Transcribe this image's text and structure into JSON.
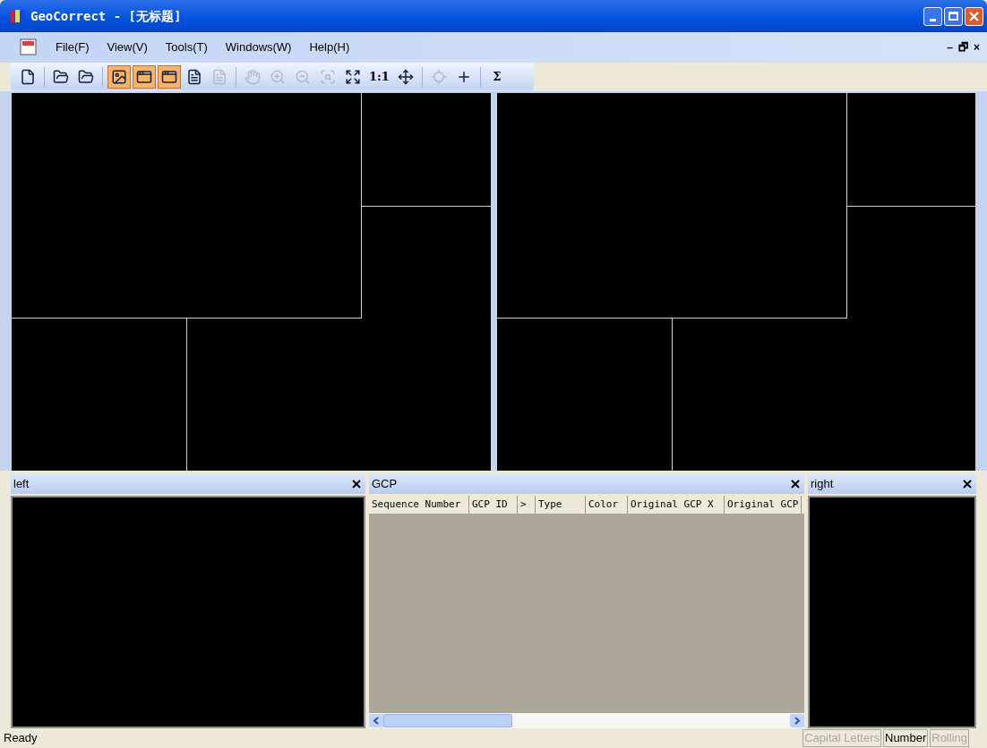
{
  "window": {
    "title": "GeoCorrect - [无标题]"
  },
  "menu": {
    "items": [
      "File(F)",
      "View(V)",
      "Tools(T)",
      "Windows(W)",
      "Help(H)"
    ],
    "mdi_controls": [
      "–",
      "🗗",
      "×"
    ]
  },
  "toolbar": [
    {
      "kind": "button",
      "disabled": false,
      "selected": false
    },
    {
      "kind": "separator"
    },
    {
      "kind": "button",
      "disabled": false,
      "selected": false
    },
    {
      "kind": "button",
      "disabled": false,
      "selected": false
    },
    {
      "kind": "separator"
    },
    {
      "kind": "button",
      "disabled": false,
      "selected": true
    },
    {
      "kind": "button",
      "disabled": false,
      "selected": true
    },
    {
      "kind": "button",
      "disabled": false,
      "selected": true
    },
    {
      "kind": "button",
      "disabled": false,
      "selected": false
    },
    {
      "kind": "button",
      "disabled": true,
      "selected": false
    },
    {
      "kind": "separator"
    },
    {
      "kind": "button",
      "disabled": true,
      "selected": false
    },
    {
      "kind": "button",
      "disabled": true,
      "selected": false
    },
    {
      "kind": "button",
      "disabled": true,
      "selected": false
    },
    {
      "kind": "button",
      "disabled": true,
      "selected": false
    },
    {
      "kind": "button",
      "disabled": false,
      "selected": false
    },
    {
      "kind": "text",
      "label": "1:1",
      "disabled": false,
      "selected": false
    },
    {
      "kind": "button",
      "disabled": false,
      "selected": false
    },
    {
      "kind": "separator"
    },
    {
      "kind": "button",
      "disabled": true,
      "selected": false
    },
    {
      "kind": "button",
      "disabled": false,
      "selected": false
    },
    {
      "kind": "separator"
    },
    {
      "kind": "text",
      "label": "Σ",
      "disabled": false,
      "selected": false
    }
  ],
  "panels": [
    {
      "kind": "view",
      "title": "left"
    },
    {
      "kind": "table",
      "title": "GCP",
      "columns": [
        "Sequence Number",
        "GCP ID",
        ">",
        "Type",
        "Color",
        "Original GCP X",
        "Original GCP"
      ]
    },
    {
      "kind": "view",
      "title": "right"
    }
  ],
  "status_bar": {
    "text": "Ready",
    "indicators": [
      {
        "label": "Capital Letters",
        "disabled": true
      },
      {
        "label": "Number",
        "disabled": false
      },
      {
        "label": "Rolling",
        "disabled": true
      }
    ]
  }
}
